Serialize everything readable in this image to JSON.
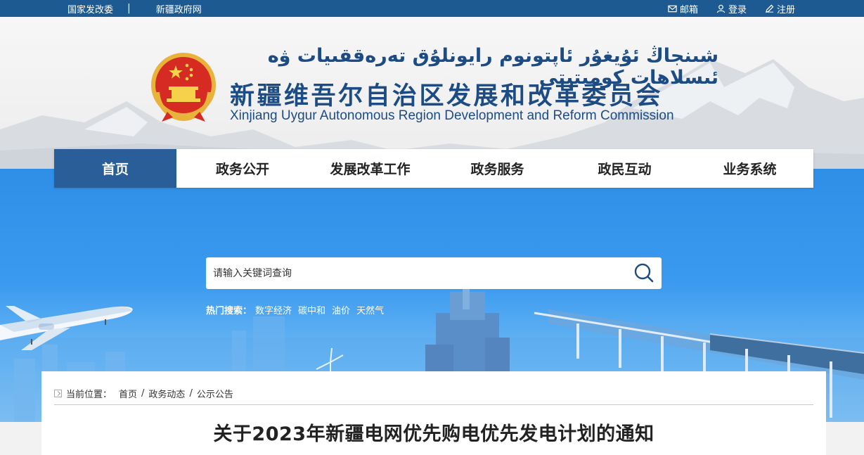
{
  "topbar": {
    "links": [
      "国家发改委",
      "新疆政府网"
    ],
    "separator": "|",
    "mail": "邮箱",
    "login": "登录",
    "register": "注册"
  },
  "header": {
    "uyghur_title": "شىنجاڭ ئۇيغۇر ئاپتونوم رايونلۇق تەرەققىيات ۋە ئىسلاھات كومىتېتى",
    "cn_title": "新疆维吾尔自治区发展和改革委员会",
    "en_title": "Xinjiang Uygur Autonomous Region Development and Reform Commission"
  },
  "nav": {
    "items": [
      "首页",
      "政务公开",
      "发展改革工作",
      "政务服务",
      "政民互动",
      "业务系统"
    ],
    "active": 0
  },
  "search": {
    "placeholder": "请输入关键词查询",
    "hot_label": "热门搜索：",
    "keywords": [
      "数字经济",
      "碳中和",
      "油价",
      "天然气"
    ]
  },
  "breadcrumb": {
    "label": "当前位置：",
    "items": [
      "首页",
      "政务动态",
      "公示公告"
    ],
    "separator": "/"
  },
  "article": {
    "title": "关于2023年新疆电网优先购电优先发电计划的通知"
  },
  "colors": {
    "topbar": "#1d5a92",
    "brand_blue": "#1c4c83",
    "nav_active": "#2a5e98",
    "banner_sky": "#3a9aef"
  }
}
